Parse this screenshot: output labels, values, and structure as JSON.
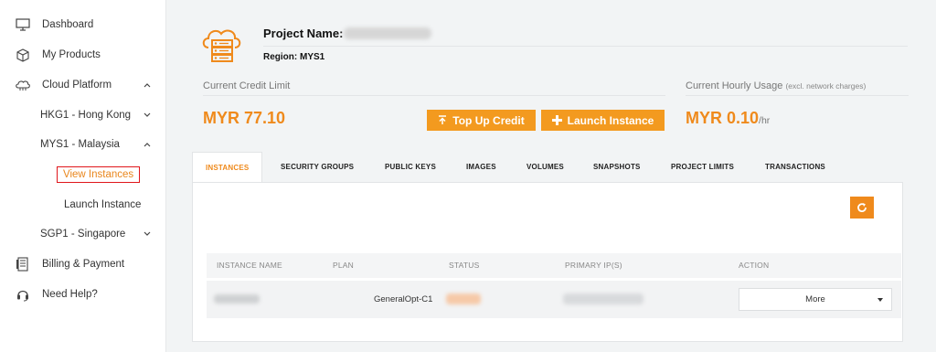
{
  "sidebar": {
    "items": [
      {
        "label": "Dashboard",
        "icon": "monitor-icon"
      },
      {
        "label": "My Products",
        "icon": "box-icon"
      },
      {
        "label": "Cloud Platform",
        "icon": "cloud-icon"
      },
      {
        "label": "HKG1 - Hong Kong"
      },
      {
        "label": "MYS1 - Malaysia"
      },
      {
        "label": "View Instances"
      },
      {
        "label": "Launch Instance"
      },
      {
        "label": "SGP1 - Singapore"
      },
      {
        "label": "Billing & Payment",
        "icon": "invoice-icon"
      },
      {
        "label": "Need Help?",
        "icon": "headset-icon"
      }
    ]
  },
  "project": {
    "name_label": "Project Name:",
    "region_label": "Region: MYS1"
  },
  "credit": {
    "label": "Current Credit Limit",
    "value": "MYR 77.10"
  },
  "buttons": {
    "topup": "Top Up Credit",
    "launch": "Launch Instance"
  },
  "hourly": {
    "label": "Current Hourly Usage",
    "note": "(excl. network charges)",
    "value": "MYR 0.10",
    "unit": "/hr"
  },
  "tabs": [
    "INSTANCES",
    "SECURITY GROUPS",
    "PUBLIC KEYS",
    "IMAGES",
    "VOLUMES",
    "SNAPSHOTS",
    "PROJECT LIMITS",
    "TRANSACTIONS"
  ],
  "table": {
    "headers": [
      "INSTANCE NAME",
      "PLAN",
      "STATUS",
      "PRIMARY IP(S)",
      "ACTION"
    ],
    "rows": [
      {
        "plan": "GeneralOpt-C1",
        "action": "More"
      }
    ]
  },
  "colors": {
    "accent": "#ef8a1c",
    "button": "#f39a1f",
    "highlight_border": "#e0161b"
  }
}
